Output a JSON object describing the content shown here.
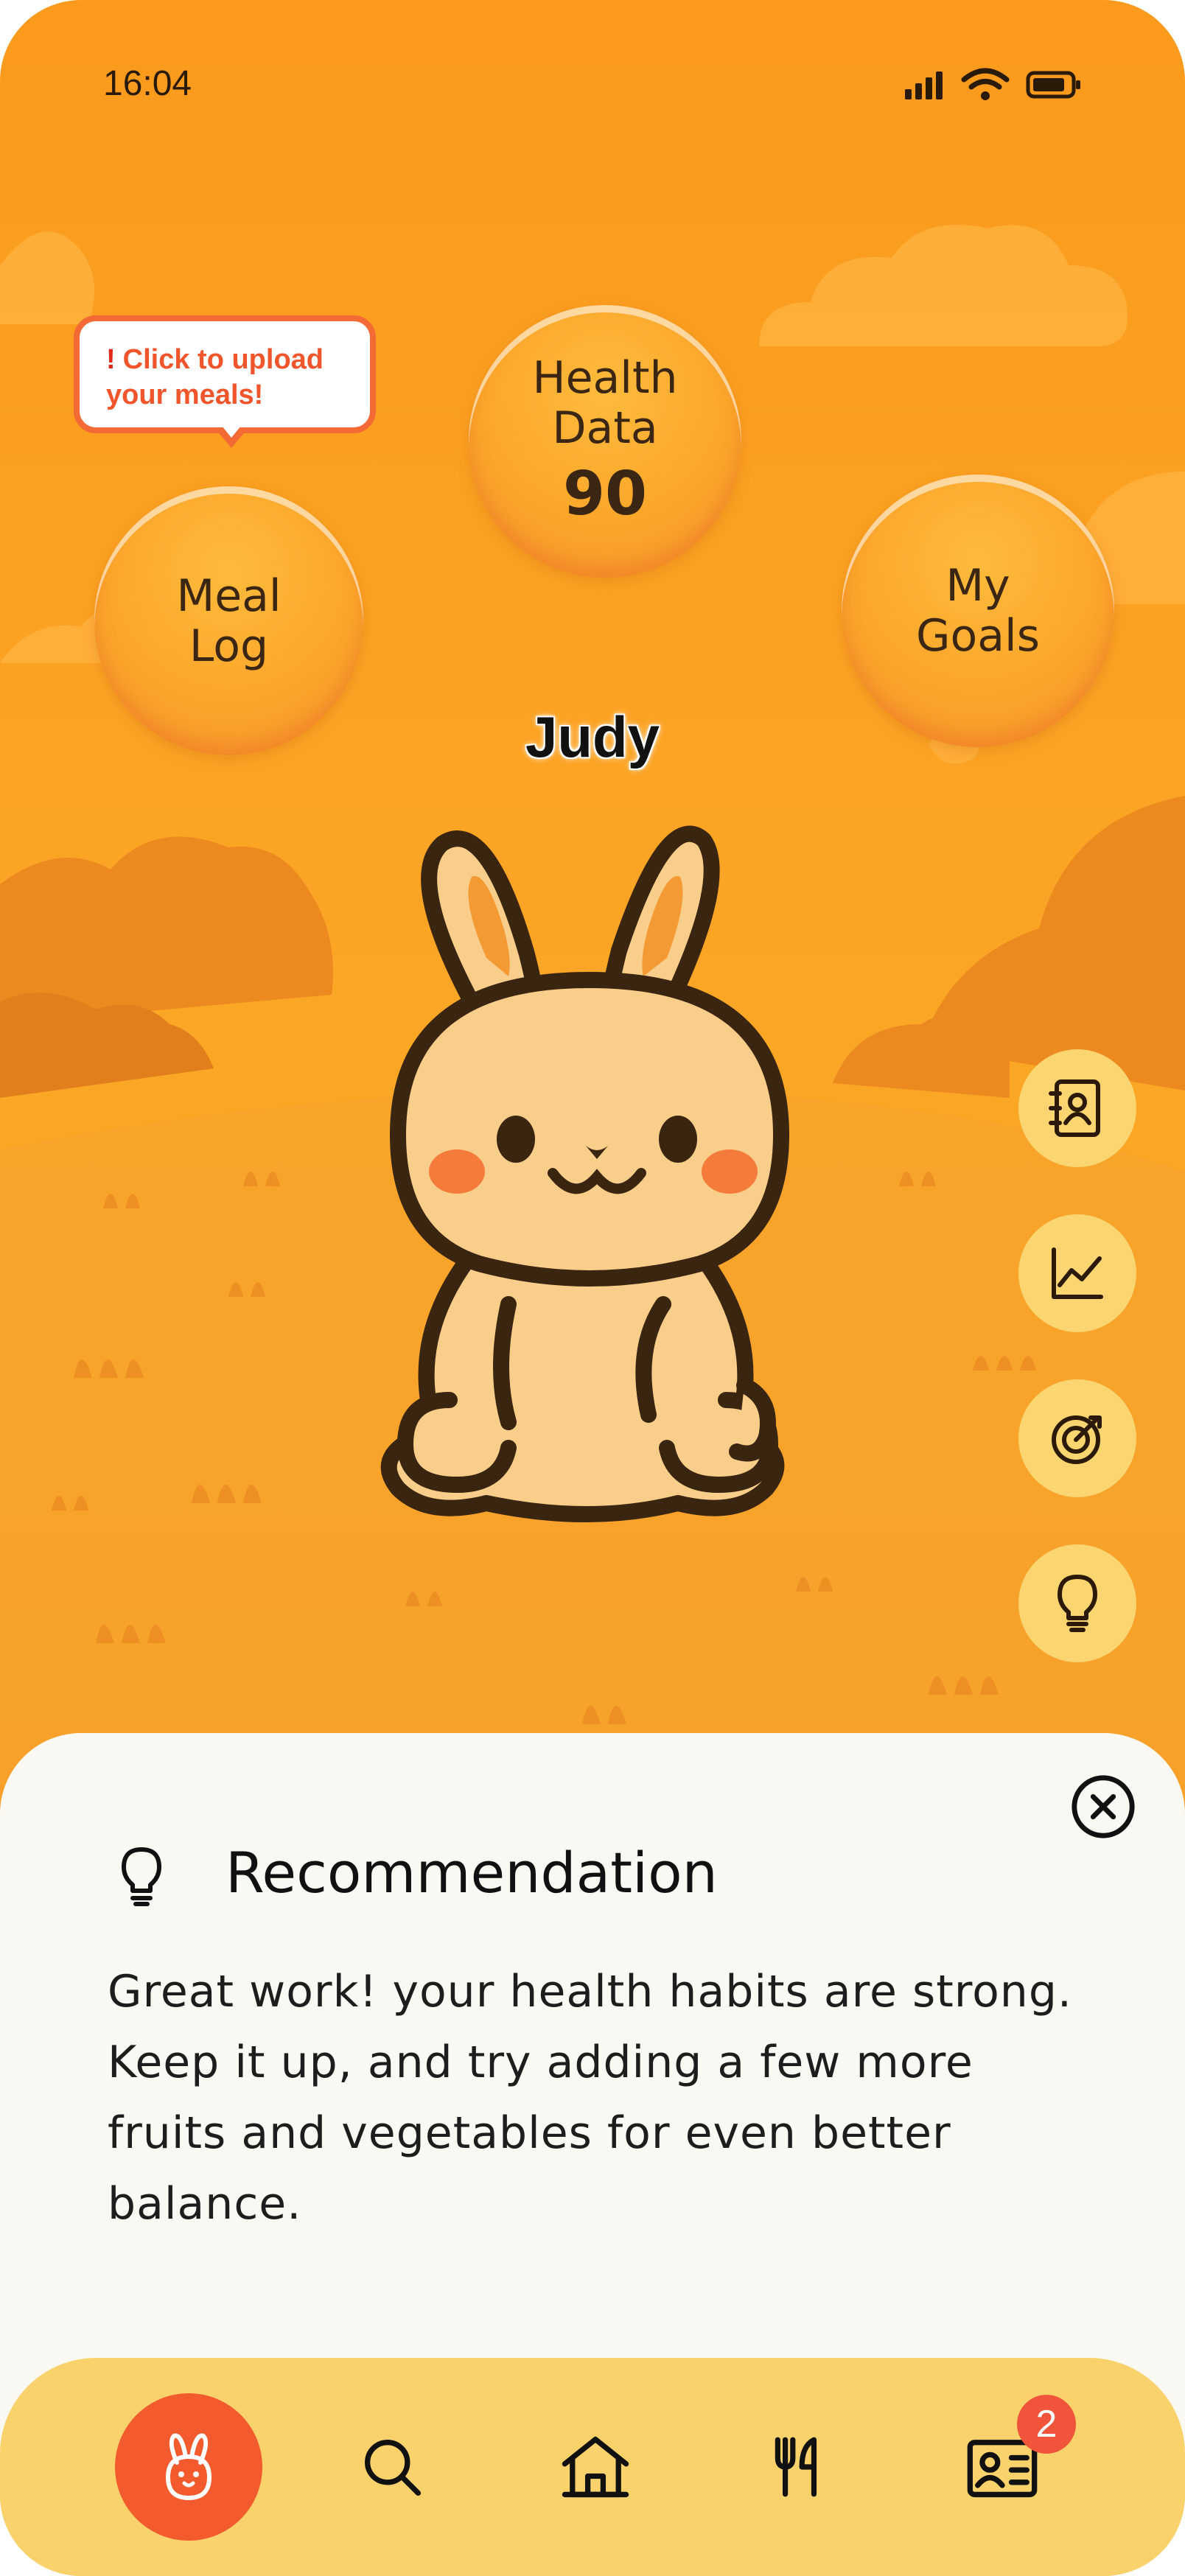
{
  "status_bar": {
    "time": "16:04"
  },
  "tooltip": {
    "icon": "!",
    "text": "Click to upload your meals!"
  },
  "bubbles": {
    "meal_log": "Meal Log",
    "health_data_label": "Health Data",
    "health_data_value": "90",
    "my_goals": "My Goals"
  },
  "pet": {
    "name": "Judy"
  },
  "side_actions": [
    "contacts-book-icon",
    "chart-icon",
    "target-icon",
    "lightbulb-icon"
  ],
  "recommendation": {
    "title": "Recommendation",
    "body": "Great work! your health habits are strong. Keep it up, and try adding a few more fruits and vegetables for even better balance."
  },
  "tabbar": {
    "tabs": [
      "bunny-icon",
      "search-icon",
      "home-icon",
      "utensils-icon",
      "profile-card-icon"
    ],
    "active": "bunny-icon",
    "badge_count": "2"
  },
  "colors": {
    "background": "#fca626",
    "accent": "#f35b2f",
    "tabbar": "#fad26c",
    "card": "#faf8f3"
  }
}
